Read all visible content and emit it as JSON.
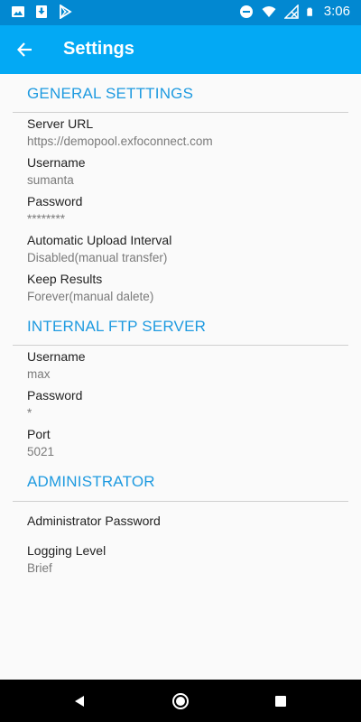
{
  "status_bar": {
    "time": "3:06",
    "left_icons": [
      "image-icon",
      "download-icon",
      "play-store-icon"
    ],
    "right_icons": [
      "do-not-disturb-icon",
      "wifi-icon",
      "signal-icon",
      "battery-icon"
    ]
  },
  "app_bar": {
    "title": "Settings",
    "back_icon": "arrow-back-icon"
  },
  "sections": {
    "general": {
      "title": "GENERAL SETTTINGS",
      "items": [
        {
          "title": "Server URL",
          "summary": "https://demopool.exfoconnect.com"
        },
        {
          "title": "Username",
          "summary": "sumanta"
        },
        {
          "title": "Password",
          "summary": "********"
        },
        {
          "title": "Automatic Upload Interval",
          "summary": "Disabled(manual transfer)"
        },
        {
          "title": "Keep Results",
          "summary": "Forever(manual dalete)"
        }
      ]
    },
    "ftp": {
      "title": "INTERNAL FTP SERVER",
      "items": [
        {
          "title": "Username",
          "summary": "max"
        },
        {
          "title": "Password",
          "summary": "*"
        },
        {
          "title": "Port",
          "summary": "5021"
        }
      ]
    },
    "admin": {
      "title": "ADMINISTRATOR",
      "items": [
        {
          "title": "Administrator Password",
          "summary": ""
        },
        {
          "title": "Logging Level",
          "summary": "Brief"
        }
      ]
    }
  },
  "nav_bar": {
    "buttons": [
      "back-triangle-icon",
      "home-circle-icon",
      "recents-square-icon"
    ]
  },
  "colors": {
    "status_bar": "#0288d1",
    "app_bar": "#03a9f4",
    "accent": "#1e9ae0",
    "background": "#fafafa"
  }
}
